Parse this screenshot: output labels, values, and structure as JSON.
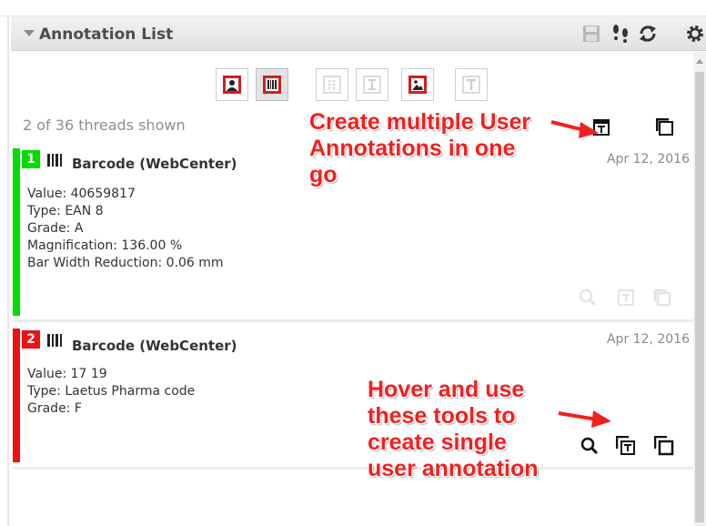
{
  "panel": {
    "title": "Annotation List",
    "tools": [
      {
        "icon": "save-icon"
      },
      {
        "icon": "footsteps-icon"
      },
      {
        "icon": "refresh-icon"
      },
      {
        "icon": "settings-gear-icon"
      }
    ]
  },
  "filters": [
    {
      "icon": "user-annotation-filter-icon",
      "active": false,
      "enabled": true
    },
    {
      "icon": "barcode-filter-icon",
      "active": true,
      "enabled": true
    },
    {
      "icon": "grid-filter-icon",
      "active": false,
      "enabled": false
    },
    {
      "icon": "text-cursor-filter-icon",
      "active": false,
      "enabled": false
    },
    {
      "icon": "image-filter-icon",
      "active": false,
      "enabled": true
    },
    {
      "icon": "text-filter-icon",
      "active": false,
      "enabled": false
    }
  ],
  "threads_count": "2 of 36 threads shown",
  "threads": [
    {
      "number": "1",
      "color": "#00dd00",
      "title": "Barcode (WebCenter)",
      "date": "Apr 12, 2016",
      "lines": [
        "Value: 40659817",
        "Type: EAN 8",
        "Grade: A",
        "Magnification: 136.00 %",
        "Bar Width Reduction: 0.06 mm"
      ]
    },
    {
      "number": "2",
      "color": "#ee1111",
      "title": "Barcode (WebCenter)",
      "date": "Apr 12, 2016",
      "lines": [
        "Value: 17 19",
        "Type: Laetus Pharma code",
        "Grade: F"
      ]
    }
  ],
  "callouts": {
    "multiple": [
      "Create multiple User",
      "Annotations in one",
      "go"
    ],
    "single": [
      "Hover and use",
      "these tools to",
      "create single",
      "user annotation"
    ]
  },
  "colors": {
    "callout": "#f21f1f",
    "arrow": "#f21f1f"
  }
}
